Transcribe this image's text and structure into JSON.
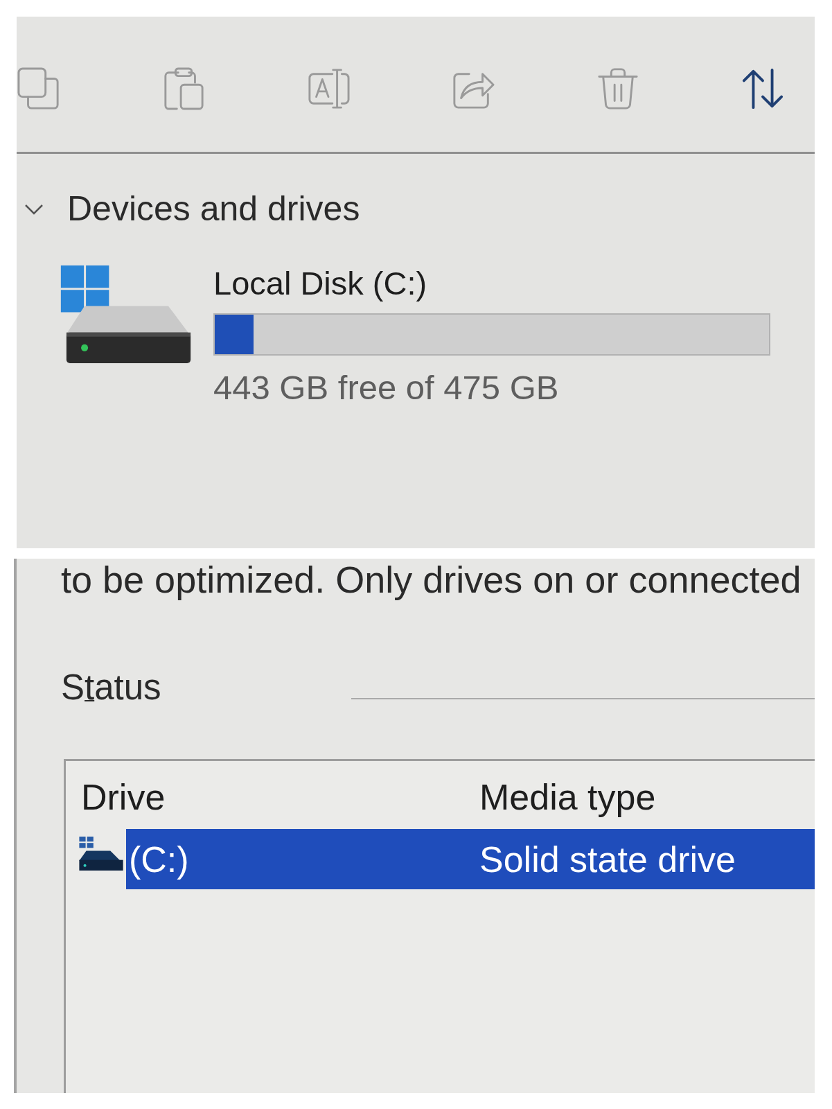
{
  "toolbar": {
    "buttons": [
      {
        "kind": "copy",
        "disabled": true
      },
      {
        "kind": "paste",
        "disabled": true
      },
      {
        "kind": "rename",
        "disabled": true
      },
      {
        "kind": "share",
        "disabled": true
      },
      {
        "kind": "delete",
        "disabled": true
      },
      {
        "kind": "sort",
        "disabled": false
      }
    ]
  },
  "devices_section": {
    "title": "Devices and drives",
    "expanded": true,
    "drives": [
      {
        "name": "Local Disk (C:)",
        "level": 0.07,
        "space": "443 GB free of 475 GB"
      }
    ]
  },
  "optimize_panel": {
    "description": "to be optimized. Only drives on or connected",
    "status_label": {
      "before_access_key": "S",
      "access_key": "t",
      "after_access_key": "atus"
    },
    "list": {
      "columns": [
        "Drive",
        "Media type"
      ],
      "rows": [
        {
          "drive": "(C:)",
          "media_type": "Solid state drive",
          "selected": true
        }
      ]
    }
  }
}
